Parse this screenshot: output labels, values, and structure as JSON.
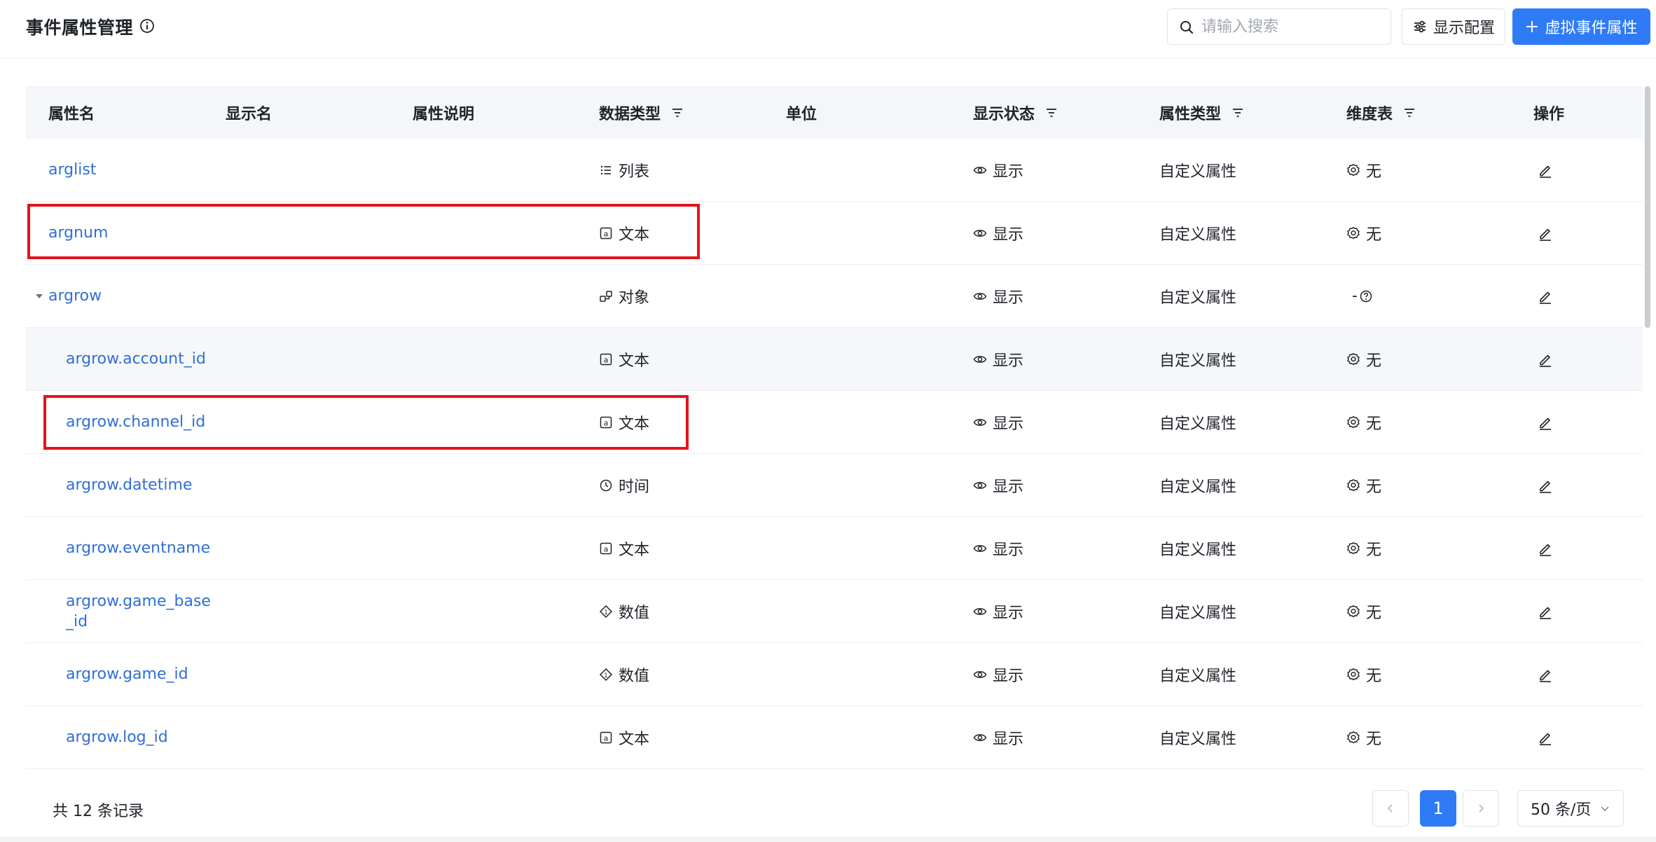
{
  "header": {
    "title": "事件属性管理",
    "search_placeholder": "请输入搜索",
    "config_label": "显示配置",
    "add_label": "虚拟事件属性"
  },
  "columns": [
    {
      "key": "name",
      "label": "属性名"
    },
    {
      "key": "display",
      "label": "显示名"
    },
    {
      "key": "desc",
      "label": "属性说明"
    },
    {
      "key": "datatype",
      "label": "数据类型",
      "filter": true
    },
    {
      "key": "unit",
      "label": "单位"
    },
    {
      "key": "status",
      "label": "显示状态",
      "filter": true
    },
    {
      "key": "attrtype",
      "label": "属性类型",
      "filter": true
    },
    {
      "key": "dim",
      "label": "维度表",
      "filter": true
    },
    {
      "key": "ops",
      "label": "操作"
    }
  ],
  "rows": [
    {
      "name": "arglist",
      "datatype": "列表",
      "datatype_icon": "list-icon",
      "status": "显示",
      "attrtype": "自定义属性",
      "dim": "无",
      "child": false
    },
    {
      "name": "argnum",
      "datatype": "文本",
      "datatype_icon": "text-icon",
      "status": "显示",
      "attrtype": "自定义属性",
      "dim": "无",
      "child": false
    },
    {
      "name": "argrow",
      "datatype": "对象",
      "datatype_icon": "object-icon",
      "status": "显示",
      "attrtype": "自定义属性",
      "dim": "-",
      "child": false,
      "expanded": true
    },
    {
      "name": "argrow.account_id",
      "datatype": "文本",
      "datatype_icon": "text-icon",
      "status": "显示",
      "attrtype": "自定义属性",
      "dim": "无",
      "child": true
    },
    {
      "name": "argrow.channel_id",
      "datatype": "文本",
      "datatype_icon": "text-icon",
      "status": "显示",
      "attrtype": "自定义属性",
      "dim": "无",
      "child": true
    },
    {
      "name": "argrow.datetime",
      "datatype": "时间",
      "datatype_icon": "clock-icon",
      "status": "显示",
      "attrtype": "自定义属性",
      "dim": "无",
      "child": true
    },
    {
      "name": "argrow.eventname",
      "datatype": "文本",
      "datatype_icon": "text-icon",
      "status": "显示",
      "attrtype": "自定义属性",
      "dim": "无",
      "child": true
    },
    {
      "name": "argrow.game_base\n_id",
      "datatype": "数值",
      "datatype_icon": "number-icon",
      "status": "显示",
      "attrtype": "自定义属性",
      "dim": "无",
      "child": true
    },
    {
      "name": "argrow.game_id",
      "datatype": "数值",
      "datatype_icon": "number-icon",
      "status": "显示",
      "attrtype": "自定义属性",
      "dim": "无",
      "child": true
    },
    {
      "name": "argrow.log_id",
      "datatype": "文本",
      "datatype_icon": "text-icon",
      "status": "显示",
      "attrtype": "自定义属性",
      "dim": "无",
      "child": true
    }
  ],
  "footer": {
    "total_text": "共 12 条记录",
    "current_page": "1",
    "page_size": "50 条/页"
  },
  "colors": {
    "primary": "#2f7bf5",
    "link": "#2f6fd6",
    "highlight": "#e2141b"
  }
}
